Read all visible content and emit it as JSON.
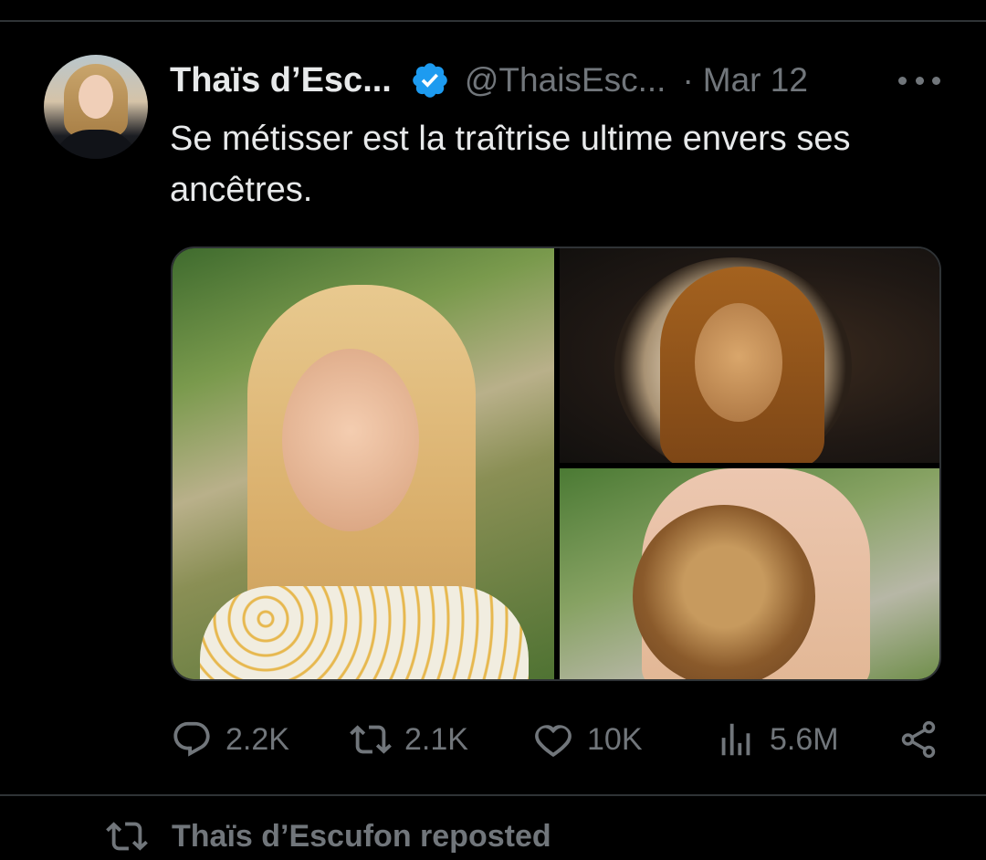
{
  "tweet": {
    "author_name": "Thaïs d’Esc...",
    "verified": true,
    "handle": "@ThaisEsc...",
    "separator": "·",
    "date": "Mar 12",
    "text": "Se métisser est la traîtrise ultime envers ses ancêtres."
  },
  "actions": {
    "replies": "2.2K",
    "reposts": "2.1K",
    "likes": "10K",
    "views": "5.6M"
  },
  "next_item": {
    "reposted_label": "Thaïs d’Escufon reposted"
  },
  "colors": {
    "background": "#000000",
    "text_primary": "#e7e9ea",
    "text_secondary": "#71767b",
    "verified_blue": "#1d9bf0",
    "divider": "#2f3336"
  },
  "icons": [
    "avatar",
    "verified-badge-icon",
    "more-icon",
    "reply-icon",
    "repost-icon",
    "like-icon",
    "views-icon",
    "share-icon"
  ]
}
